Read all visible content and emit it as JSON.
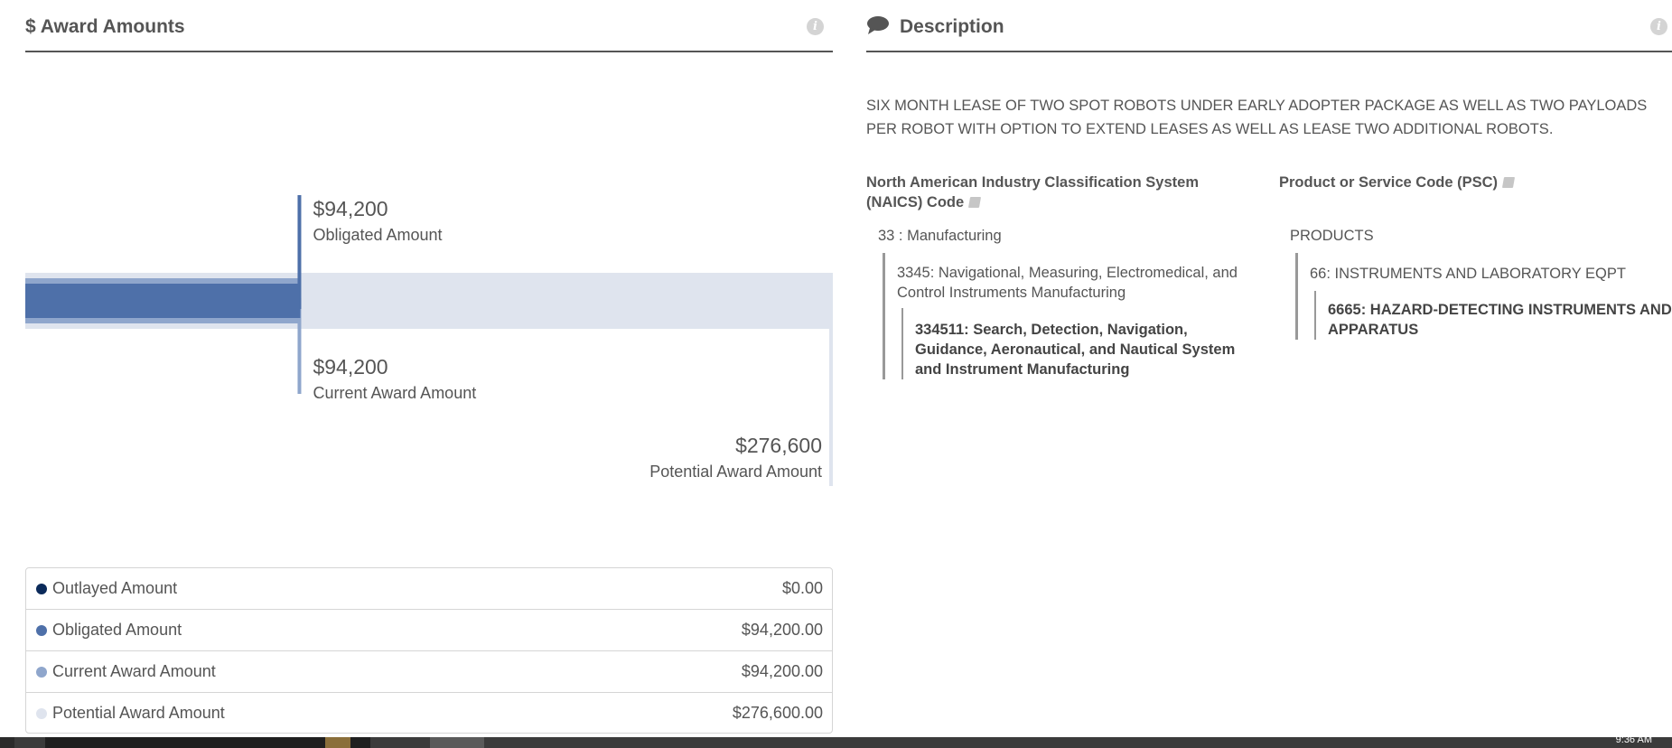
{
  "award_panel": {
    "title": "$ Award Amounts",
    "info_icon": "info-icon"
  },
  "chart_data": {
    "type": "bar",
    "categories": [
      "Outlayed Amount",
      "Obligated Amount",
      "Current Award Amount",
      "Potential Award Amount"
    ],
    "values": [
      0,
      94200,
      94200,
      276600
    ],
    "annotations": [
      {
        "value": "$94,200",
        "label": "Obligated Amount"
      },
      {
        "value": "$94,200",
        "label": "Current Award Amount"
      },
      {
        "value": "$276,600",
        "label": "Potential Award Amount"
      }
    ],
    "colors": {
      "outlayed": "#0b2a5a",
      "obligated": "#4e70a9",
      "current": "#8fa6cc",
      "potential": "#dfe4ee"
    }
  },
  "legend": [
    {
      "label": "Outlayed Amount",
      "value": "$0.00",
      "color": "#0b2a5a"
    },
    {
      "label": "Obligated Amount",
      "value": "$94,200.00",
      "color": "#4e70a9"
    },
    {
      "label": "Current Award Amount",
      "value": "$94,200.00",
      "color": "#8fa6cc"
    },
    {
      "label": "Potential Award Amount",
      "value": "$276,600.00",
      "color": "#dfe4ee"
    }
  ],
  "description_panel": {
    "title": "Description",
    "icon": "speech-bubble-icon",
    "info_icon": "info-icon",
    "text": "SIX MONTH LEASE OF TWO SPOT ROBOTS UNDER EARLY ADOPTER PACKAGE AS WELL AS TWO PAYLOADS PER ROBOT WITH OPTION TO EXTEND LEASES AS WELL AS LEASE TWO ADDITIONAL ROBOTS."
  },
  "naics": {
    "heading_line1": "North American Industry Classification System",
    "heading_line2": "(NAICS)  Code",
    "icon": "book-icon",
    "level1": "33 : Manufacturing",
    "level2_line1": "3345: Navigational, Measuring, Electromedical, and",
    "level2_line2": "Control Instruments Manufacturing",
    "level3_line1": "334511: Search, Detection, Navigation,",
    "level3_line2": "Guidance, Aeronautical, and Nautical System",
    "level3_line3": "and Instrument Manufacturing"
  },
  "psc": {
    "heading": "Product or Service Code  (PSC)",
    "icon": "book-icon",
    "level1": "PRODUCTS",
    "level2": "66: INSTRUMENTS AND LABORATORY EQPT",
    "level3_line1": "6665: HAZARD-DETECTING INSTRUMENTS AND",
    "level3_line2": "APPARATUS"
  },
  "taskbar": {
    "clock": "9:36 AM"
  }
}
